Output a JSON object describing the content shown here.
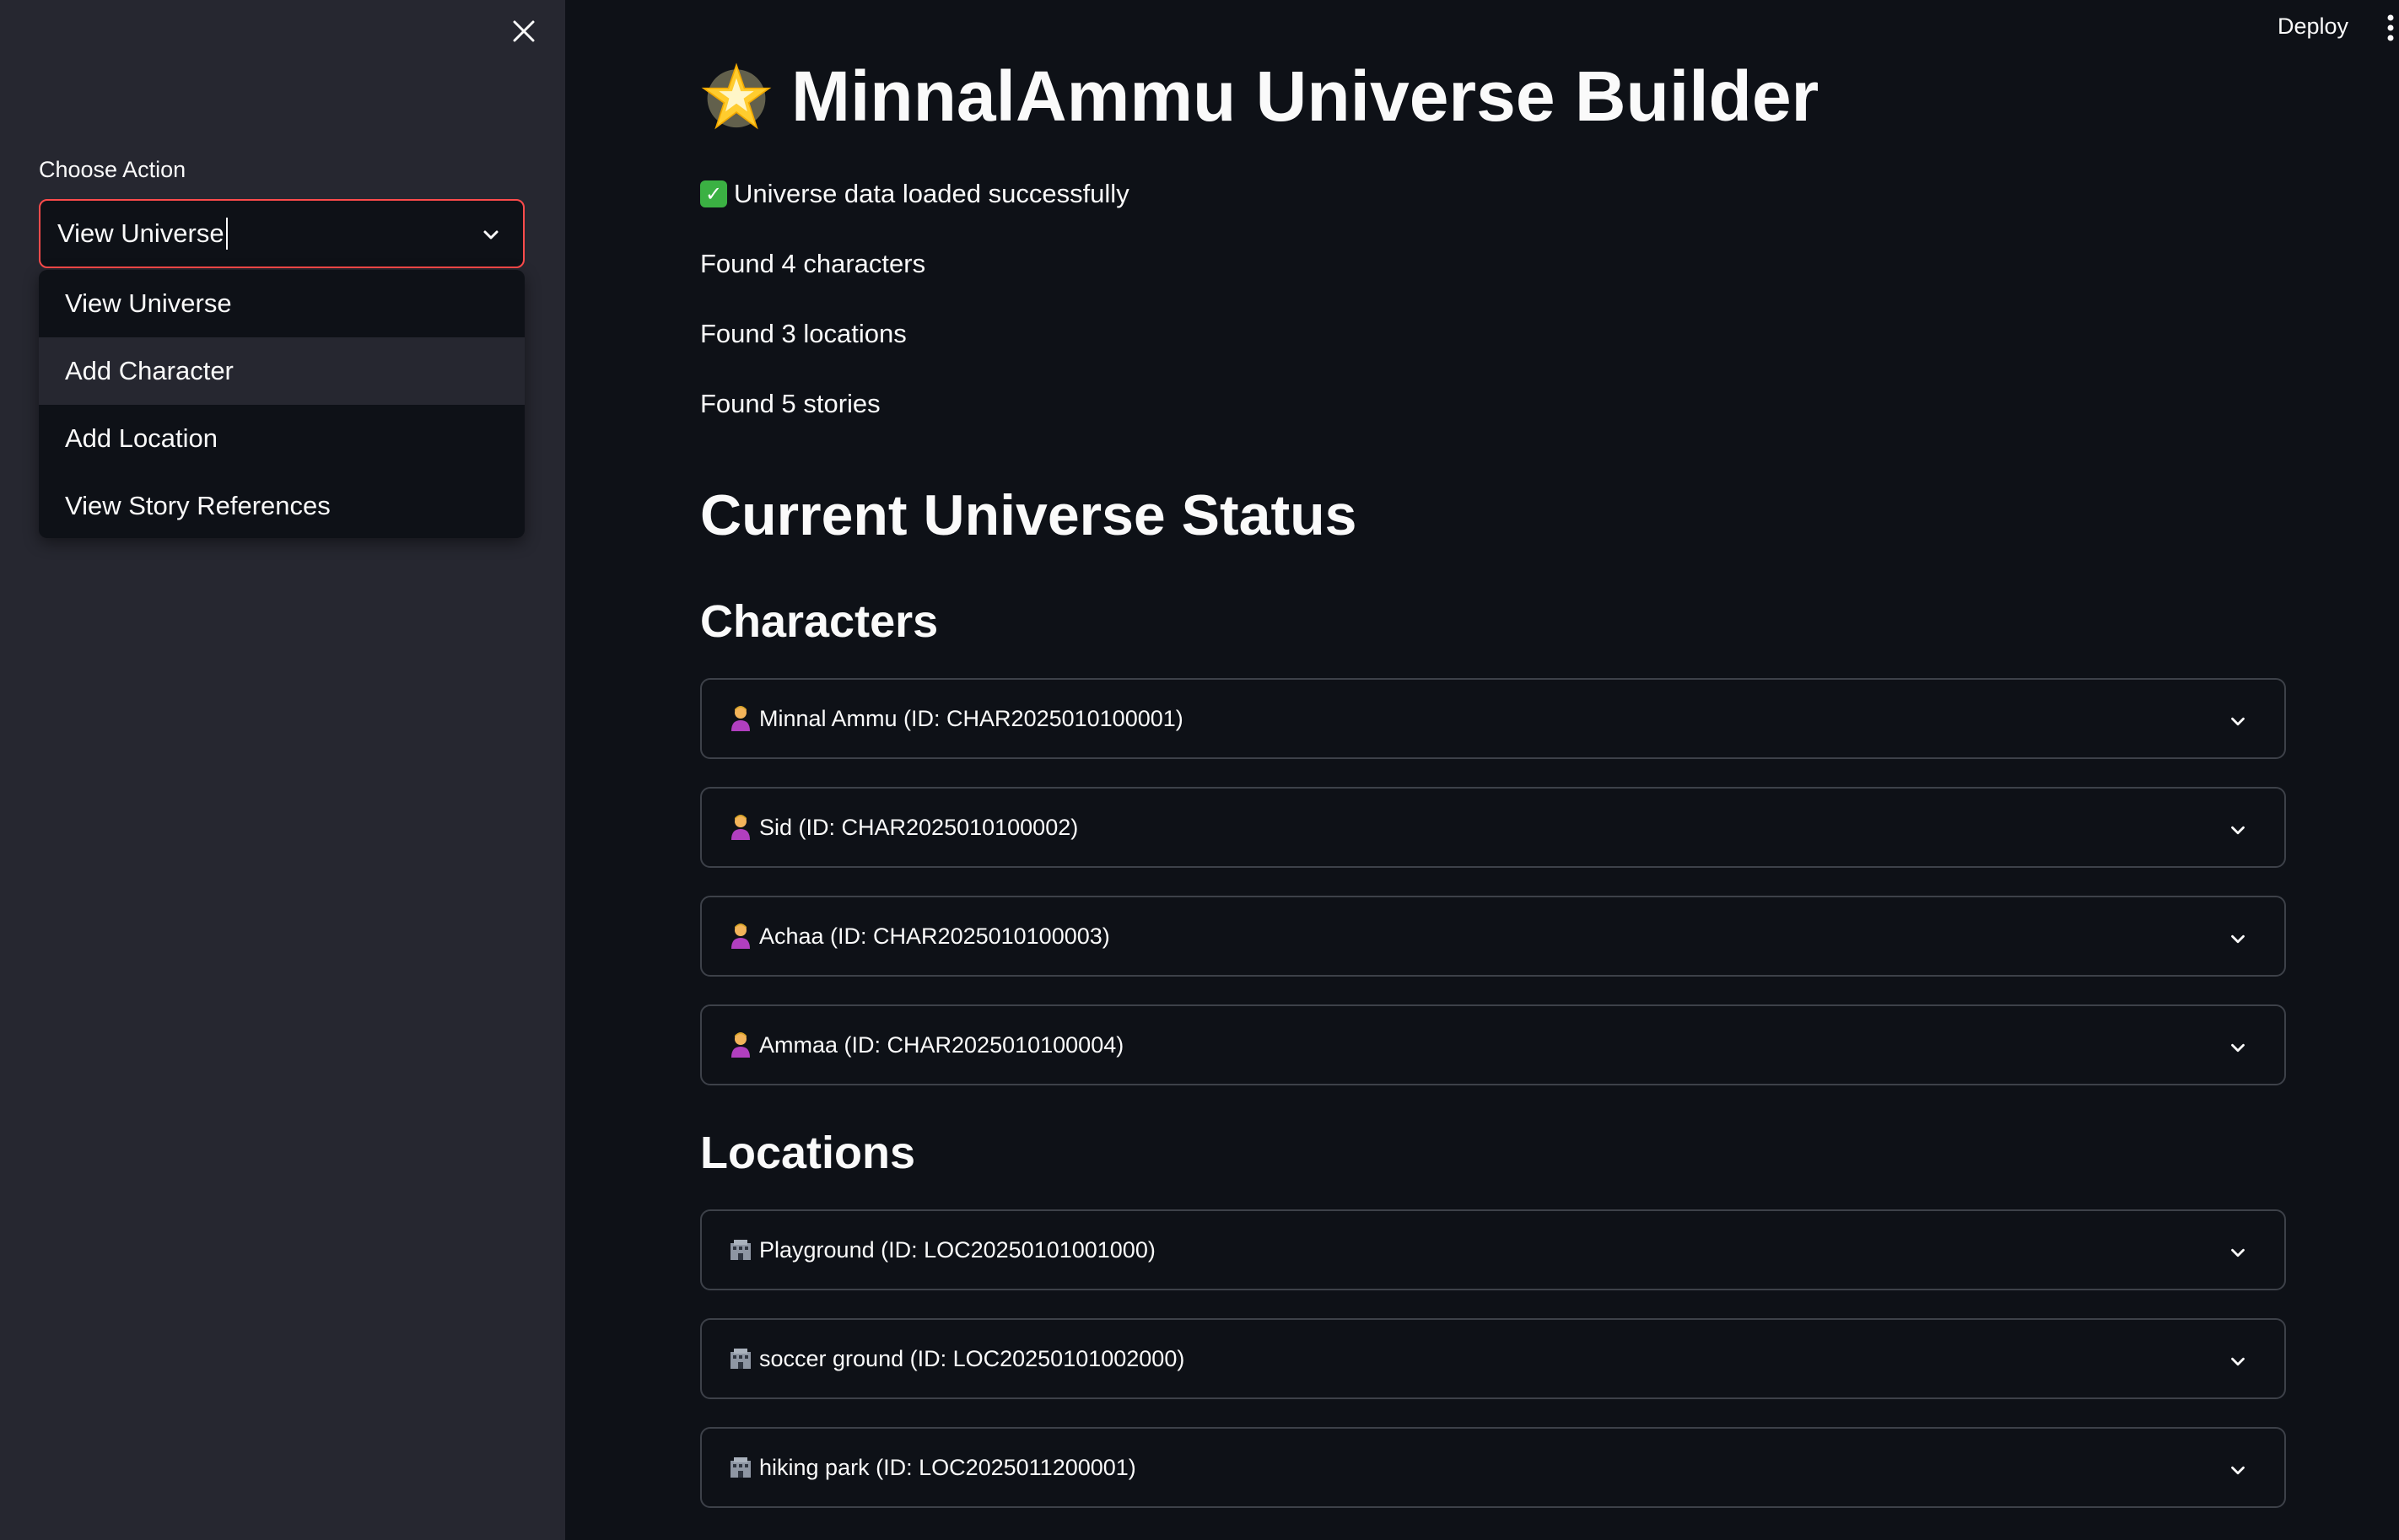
{
  "sidebar": {
    "choose_label": "Choose Action",
    "select_value": "View Universe",
    "options": [
      "View Universe",
      "Add Character",
      "Add Location",
      "View Story References"
    ]
  },
  "header": {
    "deploy_label": "Deploy"
  },
  "main": {
    "title": "MinnalAmmu Universe Builder",
    "success_message": "Universe data loaded successfully",
    "found_characters": "Found 4 characters",
    "found_locations": "Found 3 locations",
    "found_stories": "Found 5 stories",
    "status_heading": "Current Universe Status",
    "characters_heading": "Characters",
    "characters": [
      "Minnal Ammu (ID: CHAR2025010100001)",
      "Sid (ID: CHAR2025010100002)",
      "Achaa (ID: CHAR2025010100003)",
      "Ammaa (ID: CHAR2025010100004)"
    ],
    "locations_heading": "Locations",
    "locations": [
      "Playground (ID: LOC20250101001000)",
      "soccer ground (ID: LOC20250101002000)",
      "hiking park (ID: LOC2025011200001)"
    ]
  },
  "colors": {
    "background": "#0e1117",
    "sidebar": "#262730",
    "accent": "#ff4b4b",
    "border": "#3d4149",
    "success": "#3bb143"
  },
  "icons": {
    "title": "glowing-star-icon",
    "success": "check-mark-icon",
    "character": "person-icon",
    "location": "building-icon"
  }
}
